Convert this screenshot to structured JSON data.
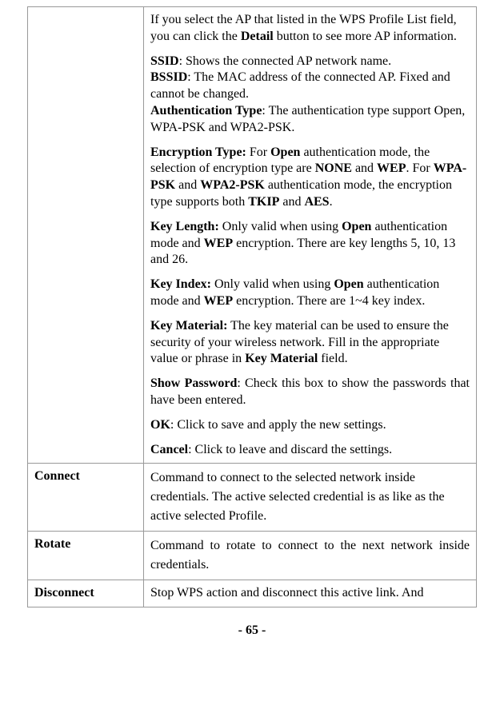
{
  "row1": {
    "label": "",
    "p1": "If you select the AP that listed in the WPS Profile List field, you can click the ",
    "p1b": "Detail",
    "p1c": " button to see more AP information.",
    "p2a": "SSID",
    "p2at": ": Shows the connected AP network name.",
    "p2b": "BSSID",
    "p2bt": ": The MAC address of the connected AP. Fixed and cannot be changed.",
    "p2c": "Authentication Type",
    "p2ct": ": The authentication type support Open, WPA-PSK and WPA2-PSK.",
    "p3a": "Encryption Type:",
    "p3b": " For ",
    "p3c": "Open",
    "p3d": " authentication mode, the selection of encryption type are ",
    "p3e": "NONE",
    "p3f": " and ",
    "p3g": "WEP",
    "p3h": ". For ",
    "p3i": "WPA-PSK",
    "p3j": " and ",
    "p3k": "WPA2-PSK",
    "p3l": " authentication mode, the encryption type supports both ",
    "p3m": "TKIP",
    "p3n": " and ",
    "p3o": "AES",
    "p3p": ".",
    "p4a": "Key Length:",
    "p4b": " Only valid when using ",
    "p4c": "Open",
    "p4d": " authentication mode and ",
    "p4e": "WEP",
    "p4f": " encryption. There are key lengths 5, 10, 13 and 26.",
    "p5a": "Key Index:",
    "p5b": " Only valid when using ",
    "p5c": "Open",
    "p5d": " authentication mode and ",
    "p5e": "WEP",
    "p5f": " encryption. There are 1~4 key index.",
    "p6a": "Key Material:",
    "p6b": " The key material can be used to ensure the security of your wireless network. Fill in the appropriate value or phrase in ",
    "p6c": "Key Material",
    "p6d": " field.",
    "p7a": "Show Password",
    "p7b": ": Check this box to show the passwords that have been entered.",
    "p8a": "OK",
    "p8b": ": Click to save and apply the new settings.",
    "p9a": "Cancel",
    "p9b": ": Click to leave and discard the settings."
  },
  "row2": {
    "label": "Connect",
    "desc": "Command to connect to the selected network inside credentials. The active selected credential is as like as the active selected Profile."
  },
  "row3": {
    "label": "Rotate",
    "desc": "Command to rotate to connect to the next network inside credentials."
  },
  "row4": {
    "label": "Disconnect",
    "desc": "Stop WPS action and disconnect this active link. And"
  },
  "page_number": "- 65 -"
}
